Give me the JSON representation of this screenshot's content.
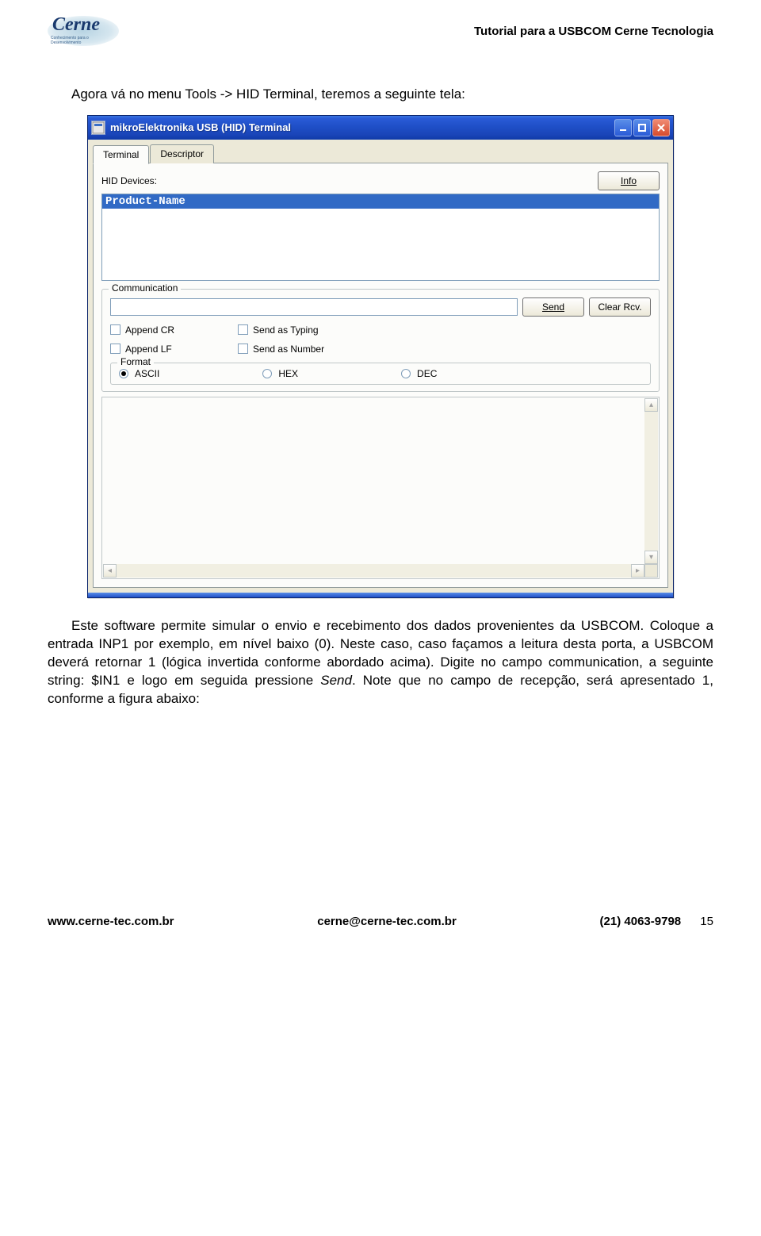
{
  "header": {
    "logo_text": "Cerne",
    "logo_sub": "Conhecimento para o Desenvolvimento",
    "doc_title": "Tutorial para a USBCOM Cerne Tecnologia"
  },
  "intro_text": "Agora vá no menu Tools -> HID Terminal, teremos a seguinte tela:",
  "window": {
    "title": "mikroElektronika USB (HID) Terminal",
    "tabs": [
      "Terminal",
      "Descriptor"
    ],
    "active_tab": 0,
    "info_btn": "Info",
    "devices_label": "HID Devices:",
    "devices": [
      "Product-Name"
    ],
    "communication": {
      "legend": "Communication",
      "input_value": "",
      "send_btn": "Send",
      "clear_btn": "Clear Rcv.",
      "checks": {
        "append_cr": "Append CR",
        "append_lf": "Append LF",
        "send_typing": "Send as Typing",
        "send_number": "Send as Number"
      }
    },
    "format": {
      "legend": "Format",
      "options": [
        "ASCII",
        "HEX",
        "DEC"
      ],
      "selected": 0
    }
  },
  "body_paragraph": "Este software permite simular o envio e recebimento dos dados provenientes da USBCOM. Coloque a entrada INP1 por exemplo, em nível baixo (0). Neste caso, caso façamos a leitura desta porta, a USBCOM deverá retornar 1 (lógica invertida conforme abordado acima). Digite no campo communication, a seguinte string: $IN1 e logo em seguida pressione Send. Note que no campo de recepção, será apresentado 1, conforme a figura abaixo:",
  "footer": {
    "site": "www.cerne-tec.com.br",
    "email": "cerne@cerne-tec.com.br",
    "phone": "(21) 4063-9798",
    "page": "15"
  }
}
